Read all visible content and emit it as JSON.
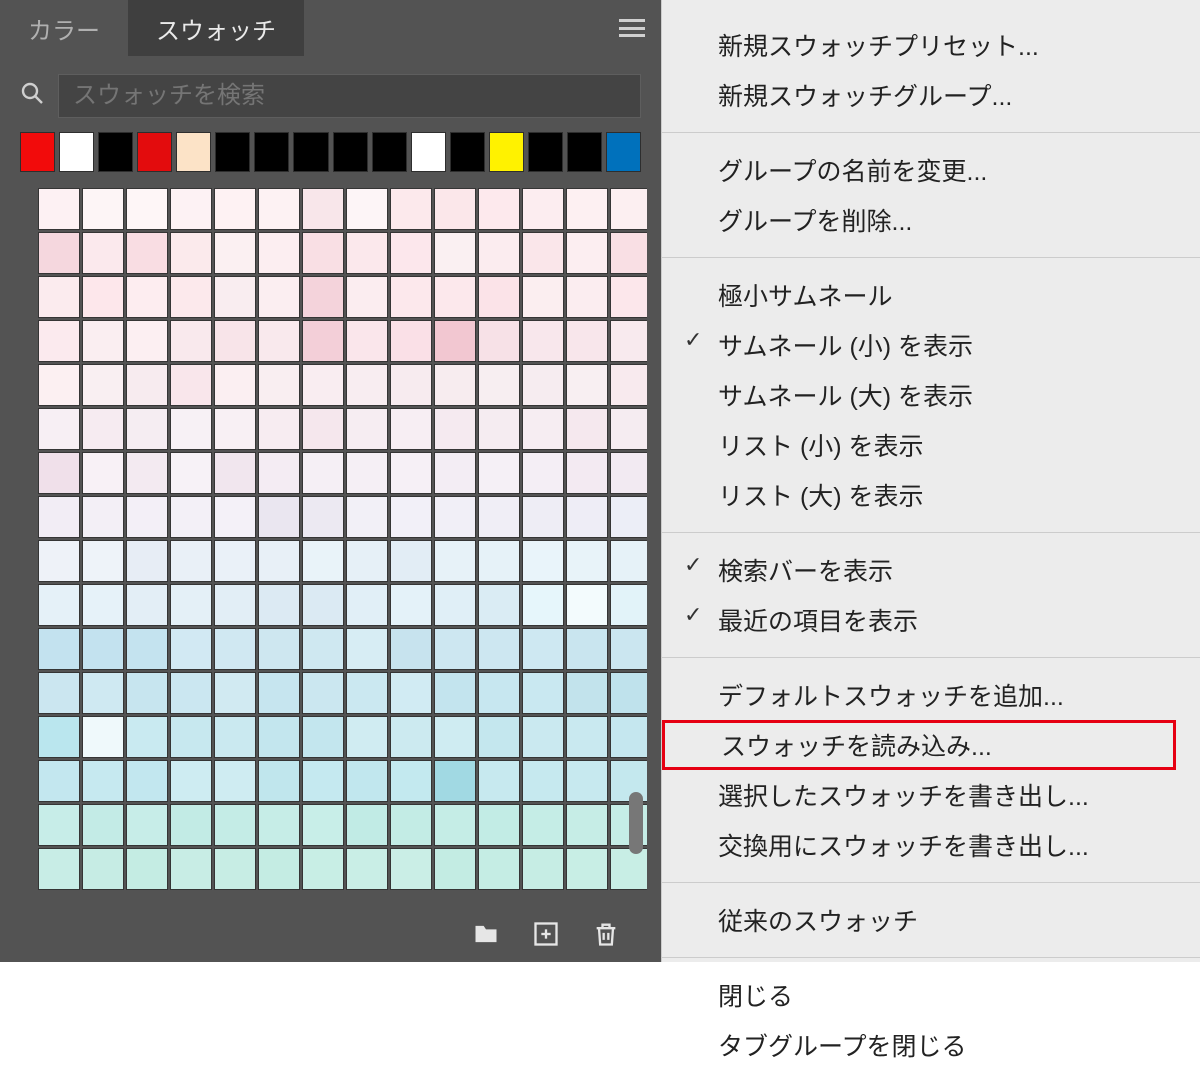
{
  "tabs": {
    "color": "カラー",
    "swatches": "スウォッチ"
  },
  "search": {
    "placeholder": "スウォッチを検索"
  },
  "recent_colors": [
    "#f20b0b",
    "#ffffff",
    "#000000",
    "#e30c0d",
    "#fce3c7",
    "#000000",
    "#000000",
    "#000000",
    "#000000",
    "#000000",
    "#ffffff",
    "#000000",
    "#fff200",
    "#000000",
    "#000000",
    "#0071bc"
  ],
  "swatch_rows": [
    [
      "#fdf1f3",
      "#fdf5f6",
      "#fef6f7",
      "#fdf2f4",
      "#fef2f3",
      "#fdf2f3",
      "#f8e6ea",
      "#fdf5f7",
      "#fce9ec",
      "#fbe7ea",
      "#fde9ed",
      "#fcedf0",
      "#fdf0f2",
      "#fceff1"
    ],
    [
      "#f5d7de",
      "#fbe9ed",
      "#f9dde3",
      "#fbeaec",
      "#fbf0f2",
      "#fceef1",
      "#f9dfe4",
      "#fbe8ec",
      "#fce7ec",
      "#faf0f2",
      "#fbecef",
      "#fae6ea",
      "#fceef1",
      "#f9dfe4"
    ],
    [
      "#fbebee",
      "#fde7eb",
      "#fdedf0",
      "#fce9ec",
      "#f9edf0",
      "#fbeef1",
      "#f4d3db",
      "#fbedf0",
      "#fce8ec",
      "#fce8ec",
      "#fbe3e8",
      "#fbeef0",
      "#fbedf0",
      "#fce7eb"
    ],
    [
      "#fbeaee",
      "#faeef1",
      "#fceff2",
      "#f9e9ed",
      "#f8e4e9",
      "#f9e9ed",
      "#f3cfd8",
      "#fae6eb",
      "#fae0e7",
      "#f2c7d1",
      "#f7e1e7",
      "#f8e7ec",
      "#f8e6eb",
      "#f8eaee"
    ],
    [
      "#fcf0f2",
      "#f9eff2",
      "#f7ebef",
      "#f9e6eb",
      "#fbeff2",
      "#f9eef1",
      "#f9edf1",
      "#f8edf1",
      "#f7ebef",
      "#f7ecef",
      "#f7eef1",
      "#f6ecf0",
      "#f8eff2",
      "#f8eaee"
    ],
    [
      "#f7eff4",
      "#f6ebf1",
      "#f5edf2",
      "#f7f1f5",
      "#f8f0f4",
      "#f7ecf1",
      "#f5e7ed",
      "#f6edf2",
      "#f7eef3",
      "#f5eaf0",
      "#f5ecf1",
      "#f6edf2",
      "#f5e8ee",
      "#f5ecf1"
    ],
    [
      "#f0e0ea",
      "#f8f1f6",
      "#f3eaf1",
      "#f7f2f7",
      "#f1e6ee",
      "#f4ecf3",
      "#f5eff5",
      "#f5eff5",
      "#f6f0f6",
      "#f3edf4",
      "#f5f0f6",
      "#f4eef5",
      "#f3eaf2",
      "#f2eaf2"
    ],
    [
      "#f2edf5",
      "#f3eff6",
      "#f3eff7",
      "#f3f0f7",
      "#f4f1f8",
      "#eae6f0",
      "#ece9f2",
      "#f2f0f7",
      "#f2f0f8",
      "#f1eff7",
      "#f0eef6",
      "#eeedf5",
      "#eeedf6",
      "#eceef7"
    ],
    [
      "#eef2f8",
      "#eef3f9",
      "#e7edf5",
      "#e9f0f7",
      "#eaf1f8",
      "#e8f0f7",
      "#e9f3f9",
      "#e6f0f7",
      "#e2edf5",
      "#e7f2f8",
      "#e6f2f8",
      "#e9f4fa",
      "#e8f3f9",
      "#e6f2f8"
    ],
    [
      "#e5f1f8",
      "#e6f2f9",
      "#e3eef6",
      "#e4f0f7",
      "#e2eef6",
      "#dceaf3",
      "#dbeaf3",
      "#e1eff7",
      "#e4f2f9",
      "#e0eff7",
      "#daecf4",
      "#e6f6fb",
      "#f3fbfd",
      "#e2f3f9"
    ],
    [
      "#c3e2ef",
      "#c3e2ef",
      "#c4e3ef",
      "#d2e9f3",
      "#d0e8f2",
      "#cee7f0",
      "#cfe8f1",
      "#d7edf4",
      "#c7e3ee",
      "#cde7f1",
      "#cde7f1",
      "#cee8f2",
      "#c9e5ef",
      "#cbe6f0"
    ],
    [
      "#cbe6f0",
      "#cfe9f2",
      "#c7e5ef",
      "#cbe7f1",
      "#d1eaf2",
      "#c6e5ef",
      "#cbe7f0",
      "#cbe8f1",
      "#d1ebf3",
      "#c3e4ee",
      "#c7e7f0",
      "#c9e8f1",
      "#c2e3ec",
      "#bfe2ec"
    ],
    [
      "#bae6ee",
      "#eff9fb",
      "#c9eaf1",
      "#c7e8ef",
      "#cae9f0",
      "#c3e6ee",
      "#c3e6ee",
      "#d0ecf2",
      "#cceaf0",
      "#cfecf2",
      "#c4e7ee",
      "#cae9f0",
      "#c9e9f0",
      "#c5e7ef"
    ],
    [
      "#c3e7ef",
      "#c6e9f0",
      "#c2e7ef",
      "#ceecf2",
      "#cfecf2",
      "#c0e6ed",
      "#c5e9f0",
      "#c1e7ee",
      "#c3e9ef",
      "#a1d9e3",
      "#c7e9ef",
      "#c6e9ef",
      "#c7e9ef",
      "#c4e8ee"
    ],
    [
      "#c7ede8",
      "#c3ebe6",
      "#c7ede8",
      "#c2ebe5",
      "#c4ece6",
      "#c6ede7",
      "#c8eee8",
      "#c1ebe5",
      "#c3ece5",
      "#c5ede6",
      "#c2ece5",
      "#c5ede6",
      "#c6ede6",
      "#c5ede6"
    ],
    [
      "#c8ede6",
      "#c6ece4",
      "#c4ece3",
      "#c8ede5",
      "#c7ede4",
      "#c4ece3",
      "#c8eee5",
      "#c9eee6",
      "#caeee6",
      "#c3ece3",
      "#c5ede4",
      "#c6ede4",
      "#c8eee5",
      "#c8eee5"
    ]
  ],
  "menu": {
    "new_preset": "新規スウォッチプリセット...",
    "new_group": "新規スウォッチグループ...",
    "rename_group": "グループの名前を変更...",
    "delete_group": "グループを削除...",
    "view_tiny": "極小サムネール",
    "view_small": "サムネール (小) を表示",
    "view_large": "サムネール (大) を表示",
    "view_list_small": "リスト (小) を表示",
    "view_list_large": "リスト (大) を表示",
    "show_search": "検索バーを表示",
    "show_recent": "最近の項目を表示",
    "add_default": "デフォルトスウォッチを追加...",
    "load": "スウォッチを読み込み...",
    "export_selected": "選択したスウォッチを書き出し...",
    "export_exchange": "交換用にスウォッチを書き出し...",
    "legacy": "従来のスウォッチ",
    "close": "閉じる",
    "close_tab_group": "タブグループを閉じる"
  }
}
